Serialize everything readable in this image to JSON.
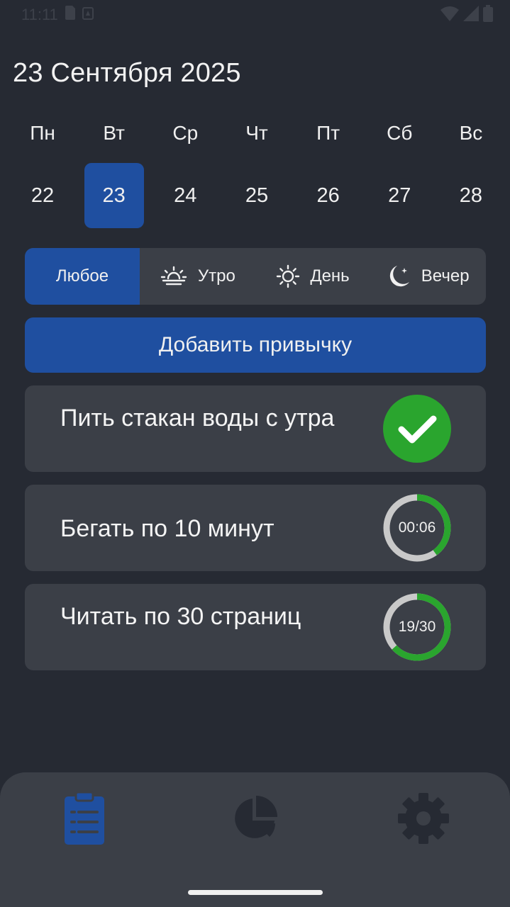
{
  "status_bar": {
    "time": "11:11"
  },
  "header": {
    "title": "23 Сентября 2025"
  },
  "week": {
    "weekdays": [
      "Пн",
      "Вт",
      "Ср",
      "Чт",
      "Пт",
      "Сб",
      "Вс"
    ],
    "dates": [
      "22",
      "23",
      "24",
      "25",
      "26",
      "27",
      "28"
    ],
    "selected_date": "23"
  },
  "filters": [
    {
      "label": "Любое",
      "icon": "none",
      "active": true
    },
    {
      "label": "Утро",
      "icon": "sunrise-icon",
      "active": false
    },
    {
      "label": "День",
      "icon": "sun-icon",
      "active": false
    },
    {
      "label": "Вечер",
      "icon": "moon-stars-icon",
      "active": false
    }
  ],
  "add_button": {
    "label": "Добавить привычку"
  },
  "habits": [
    {
      "title": "Пить стакан воды с утра",
      "status": "done",
      "status_icon": "checkmark-icon"
    },
    {
      "title": "Бегать по 10 минут",
      "status": "timer",
      "ring_label": "00:06",
      "progress": 0.4
    },
    {
      "title": "Читать по 30 страниц",
      "status": "counter",
      "ring_label": "19/30",
      "progress": 0.633
    }
  ],
  "bottom_nav": [
    {
      "name": "habits",
      "icon": "clipboard-list-icon",
      "active": true
    },
    {
      "name": "statistics",
      "icon": "pie-chart-icon",
      "active": false
    },
    {
      "name": "settings",
      "icon": "gear-icon",
      "active": false
    }
  ],
  "colors": {
    "background": "#262a33",
    "card": "#3b3f47",
    "accent": "#1f4fa0",
    "success": "#2aa52e",
    "ring_track": "#c9c9c9",
    "nav_inactive": "#262a33",
    "status_bar_text": "#3d414a"
  }
}
